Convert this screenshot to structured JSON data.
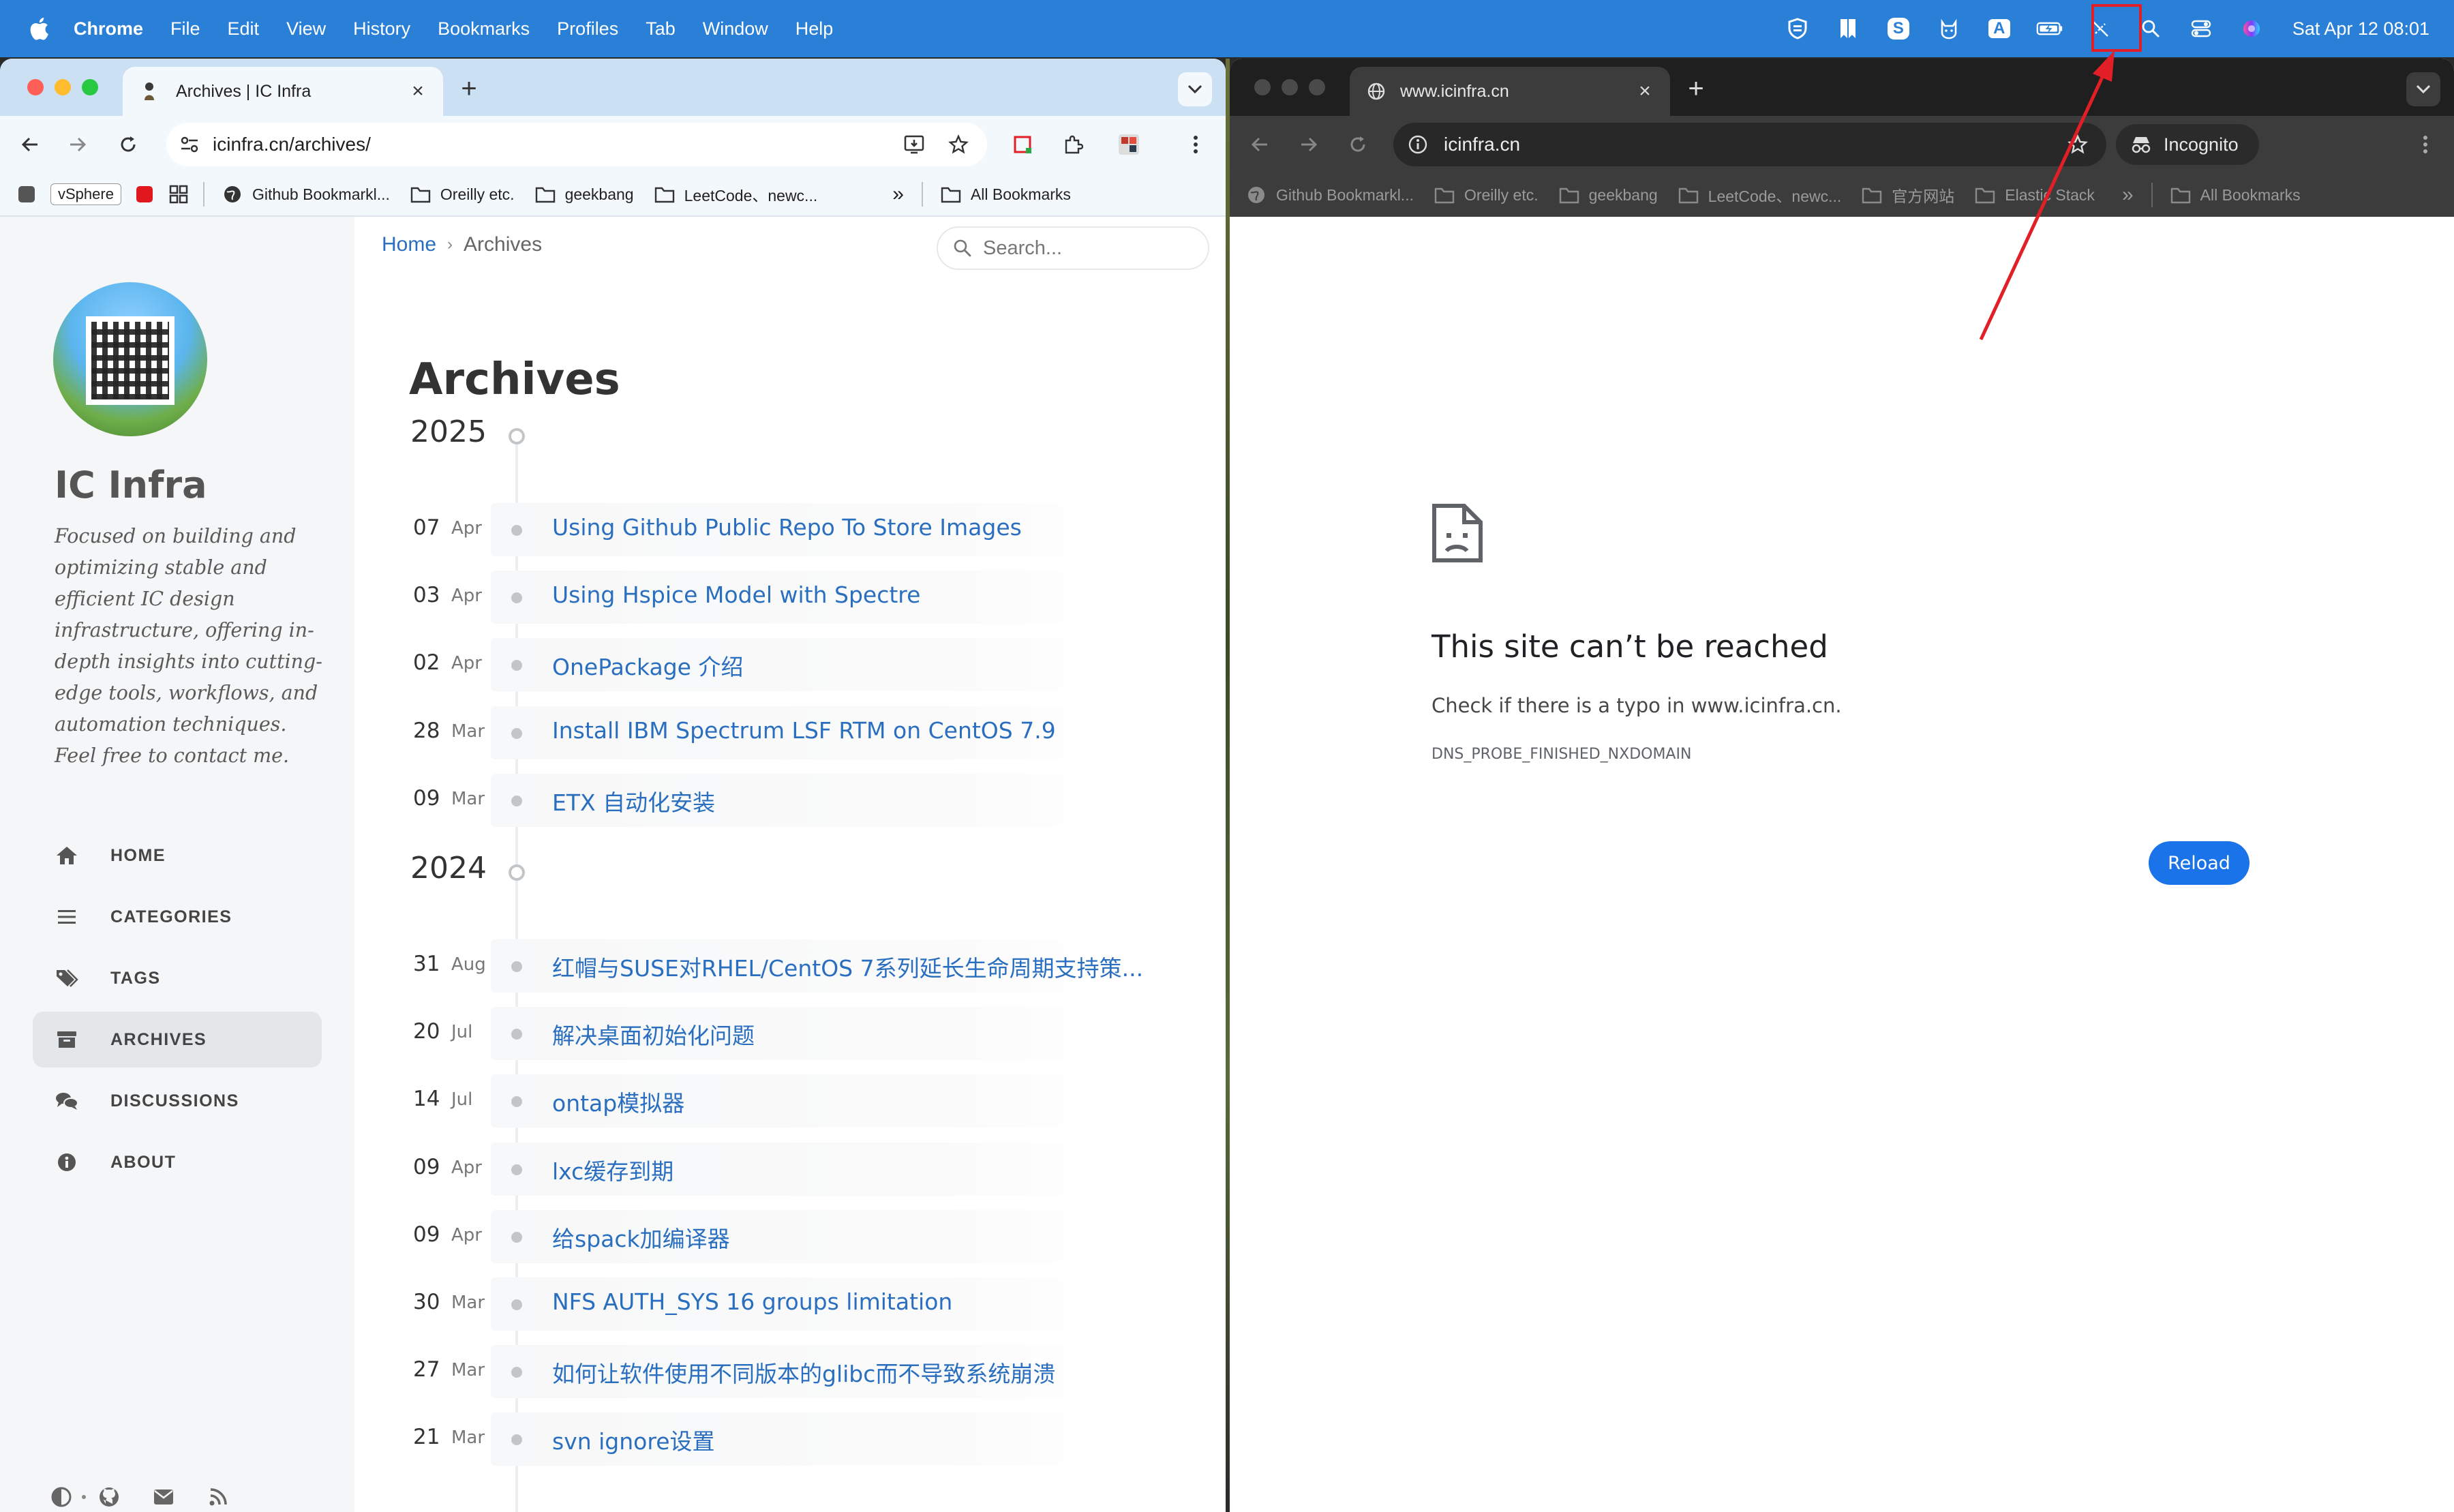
{
  "menubar": {
    "app": "Chrome",
    "items": [
      "File",
      "Edit",
      "View",
      "History",
      "Bookmarks",
      "Profiles",
      "Tab",
      "Window",
      "Help"
    ],
    "status_letters": {
      "s": "S",
      "a": "A"
    },
    "clock": "Sat Apr 12  08:01"
  },
  "left_window": {
    "tab_title": "Archives | IC Infra",
    "url": "icinfra.cn/archives/",
    "bookmarks": {
      "vsphere": "vSphere",
      "github": "Github Bookmarkl...",
      "oreilly": "Oreilly etc.",
      "geekbang": "geekbang",
      "leetcode": "LeetCode、newc...",
      "more": "»",
      "all": "All Bookmarks"
    },
    "sidebar": {
      "title": "IC Infra",
      "description": "Focused on building and optimizing stable and efficient IC design infrastructure, offering in-depth insights into cutting-edge tools, workflows, and automation techniques. Feel free to contact me.",
      "nav": [
        {
          "label": "HOME",
          "icon": "home-icon"
        },
        {
          "label": "CATEGORIES",
          "icon": "list-icon"
        },
        {
          "label": "TAGS",
          "icon": "tags-icon"
        },
        {
          "label": "ARCHIVES",
          "icon": "archive-icon"
        },
        {
          "label": "DISCUSSIONS",
          "icon": "comments-icon"
        },
        {
          "label": "ABOUT",
          "icon": "info-icon"
        }
      ],
      "active_nav": "ARCHIVES"
    },
    "breadcrumb": {
      "home": "Home",
      "sep": "›",
      "current": "Archives"
    },
    "search_placeholder": "Search...",
    "page_title": "Archives",
    "archives": [
      {
        "year": "2025",
        "posts": [
          {
            "day": "07",
            "month": "Apr",
            "title": "Using Github Public Repo To Store Images"
          },
          {
            "day": "03",
            "month": "Apr",
            "title": "Using Hspice Model with Spectre"
          },
          {
            "day": "02",
            "month": "Apr",
            "title": "OnePackage 介绍"
          },
          {
            "day": "28",
            "month": "Mar",
            "title": "Install IBM Spectrum LSF RTM on CentOS 7.9"
          },
          {
            "day": "09",
            "month": "Mar",
            "title": "ETX 自动化安装"
          }
        ]
      },
      {
        "year": "2024",
        "posts": [
          {
            "day": "31",
            "month": "Aug",
            "title": "红帽与SUSE对RHEL/CentOS 7系列延长生命周期支持策..."
          },
          {
            "day": "20",
            "month": "Jul",
            "title": "解决桌面初始化问题"
          },
          {
            "day": "14",
            "month": "Jul",
            "title": "ontap模拟器"
          },
          {
            "day": "09",
            "month": "Apr",
            "title": "lxc缓存到期"
          },
          {
            "day": "09",
            "month": "Apr",
            "title": "给spack加编译器"
          },
          {
            "day": "30",
            "month": "Mar",
            "title": "NFS AUTH_SYS 16 groups limitation"
          },
          {
            "day": "27",
            "month": "Mar",
            "title": "如何让软件使用不同版本的glibc而不导致系统崩溃"
          },
          {
            "day": "21",
            "month": "Mar",
            "title": "svn ignore设置"
          }
        ]
      }
    ]
  },
  "right_window": {
    "tab_title": "www.icinfra.cn",
    "url": "icinfra.cn",
    "incognito_label": "Incognito",
    "bookmarks": {
      "github": "Github Bookmarkl...",
      "oreilly": "Oreilly etc.",
      "geekbang": "geekbang",
      "leetcode": "LeetCode、newc...",
      "official": "官方网站",
      "elastic": "Elastic Stack",
      "more": "»",
      "all": "All Bookmarks"
    },
    "error": {
      "title": "This site can’t be reached",
      "message": "Check if there is a typo in www.icinfra.cn.",
      "code": "DNS_PROBE_FINISHED_NXDOMAIN",
      "reload": "Reload"
    }
  },
  "colors": {
    "menubar": "#2a7fd6",
    "link": "#2a6fbf",
    "annotation": "#e21f26",
    "reload_button": "#1a73e8"
  }
}
